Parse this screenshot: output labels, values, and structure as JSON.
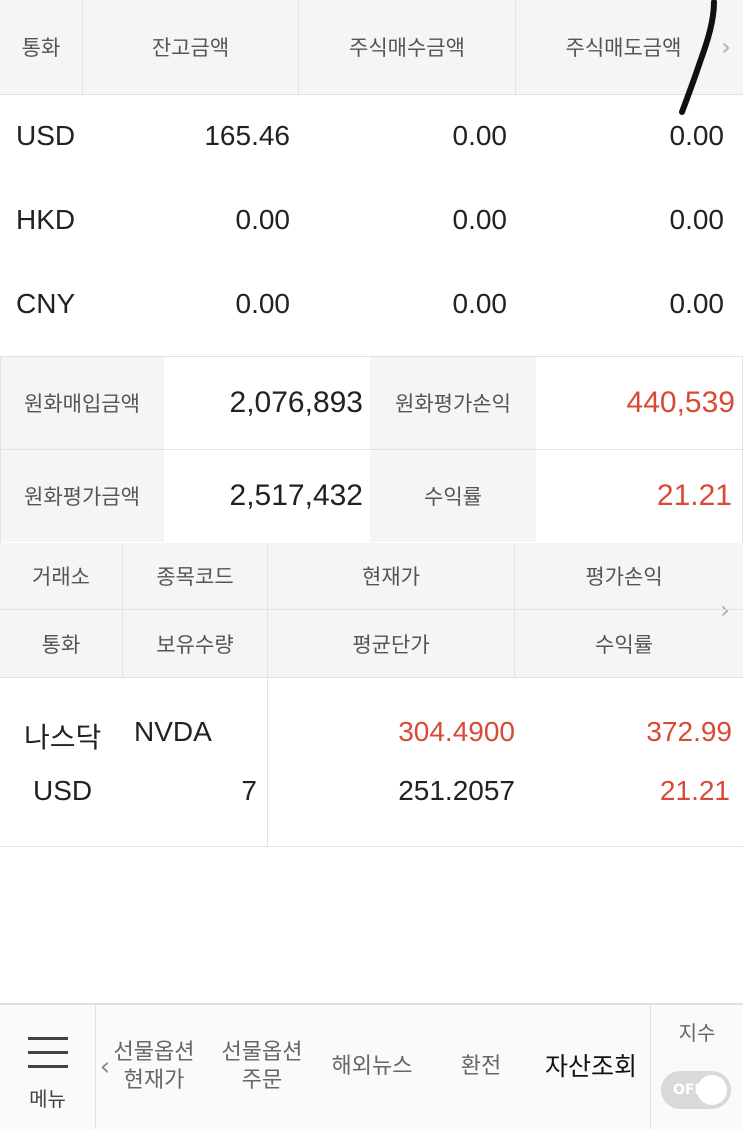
{
  "currency_table": {
    "headers": [
      "통화",
      "잔고금액",
      "주식매수금액",
      "주식매도금액"
    ],
    "rows": [
      {
        "currency": "USD",
        "balance": "165.46",
        "buy": "0.00",
        "sell": "0.00"
      },
      {
        "currency": "HKD",
        "balance": "0.00",
        "buy": "0.00",
        "sell": "0.00"
      },
      {
        "currency": "CNY",
        "balance": "0.00",
        "buy": "0.00",
        "sell": "0.00"
      }
    ],
    "more_glyph": "›"
  },
  "summary": {
    "purchase_label": "원화매입금액",
    "purchase_value": "2,076,893",
    "pl_label": "원화평가손익",
    "pl_value": "440,539",
    "eval_label": "원화평가금액",
    "eval_value": "2,517,432",
    "return_label": "수익률",
    "return_value": "21.21"
  },
  "holdings_table": {
    "headers_row1": [
      "거래소",
      "종목코드",
      "현재가",
      "평가손익"
    ],
    "headers_row2": [
      "통화",
      "보유수량",
      "평균단가",
      "수익률"
    ],
    "more_glyph": "›",
    "rows": [
      {
        "exchange": "나스닥",
        "code": "NVDA",
        "current_price": "304.4900",
        "pl": "372.99",
        "currency": "USD",
        "quantity": "7",
        "avg_price": "251.2057",
        "return": "21.21"
      }
    ]
  },
  "bottom_nav": {
    "menu_label": "메뉴",
    "back_glyph": "‹",
    "items": [
      {
        "line1": "선물옵션",
        "line2": "현재가"
      },
      {
        "line1": "선물옵션",
        "line2": "주문"
      },
      {
        "line1": "해외뉴스",
        "line2": ""
      },
      {
        "line1": "환전",
        "line2": ""
      },
      {
        "line1": "자산조회",
        "line2": ""
      }
    ],
    "index_label": "지수",
    "toggle_label": "OFF",
    "toggle_on": false
  },
  "colors": {
    "positive": "#d94a36",
    "header_bg": "#f5f5f5"
  }
}
